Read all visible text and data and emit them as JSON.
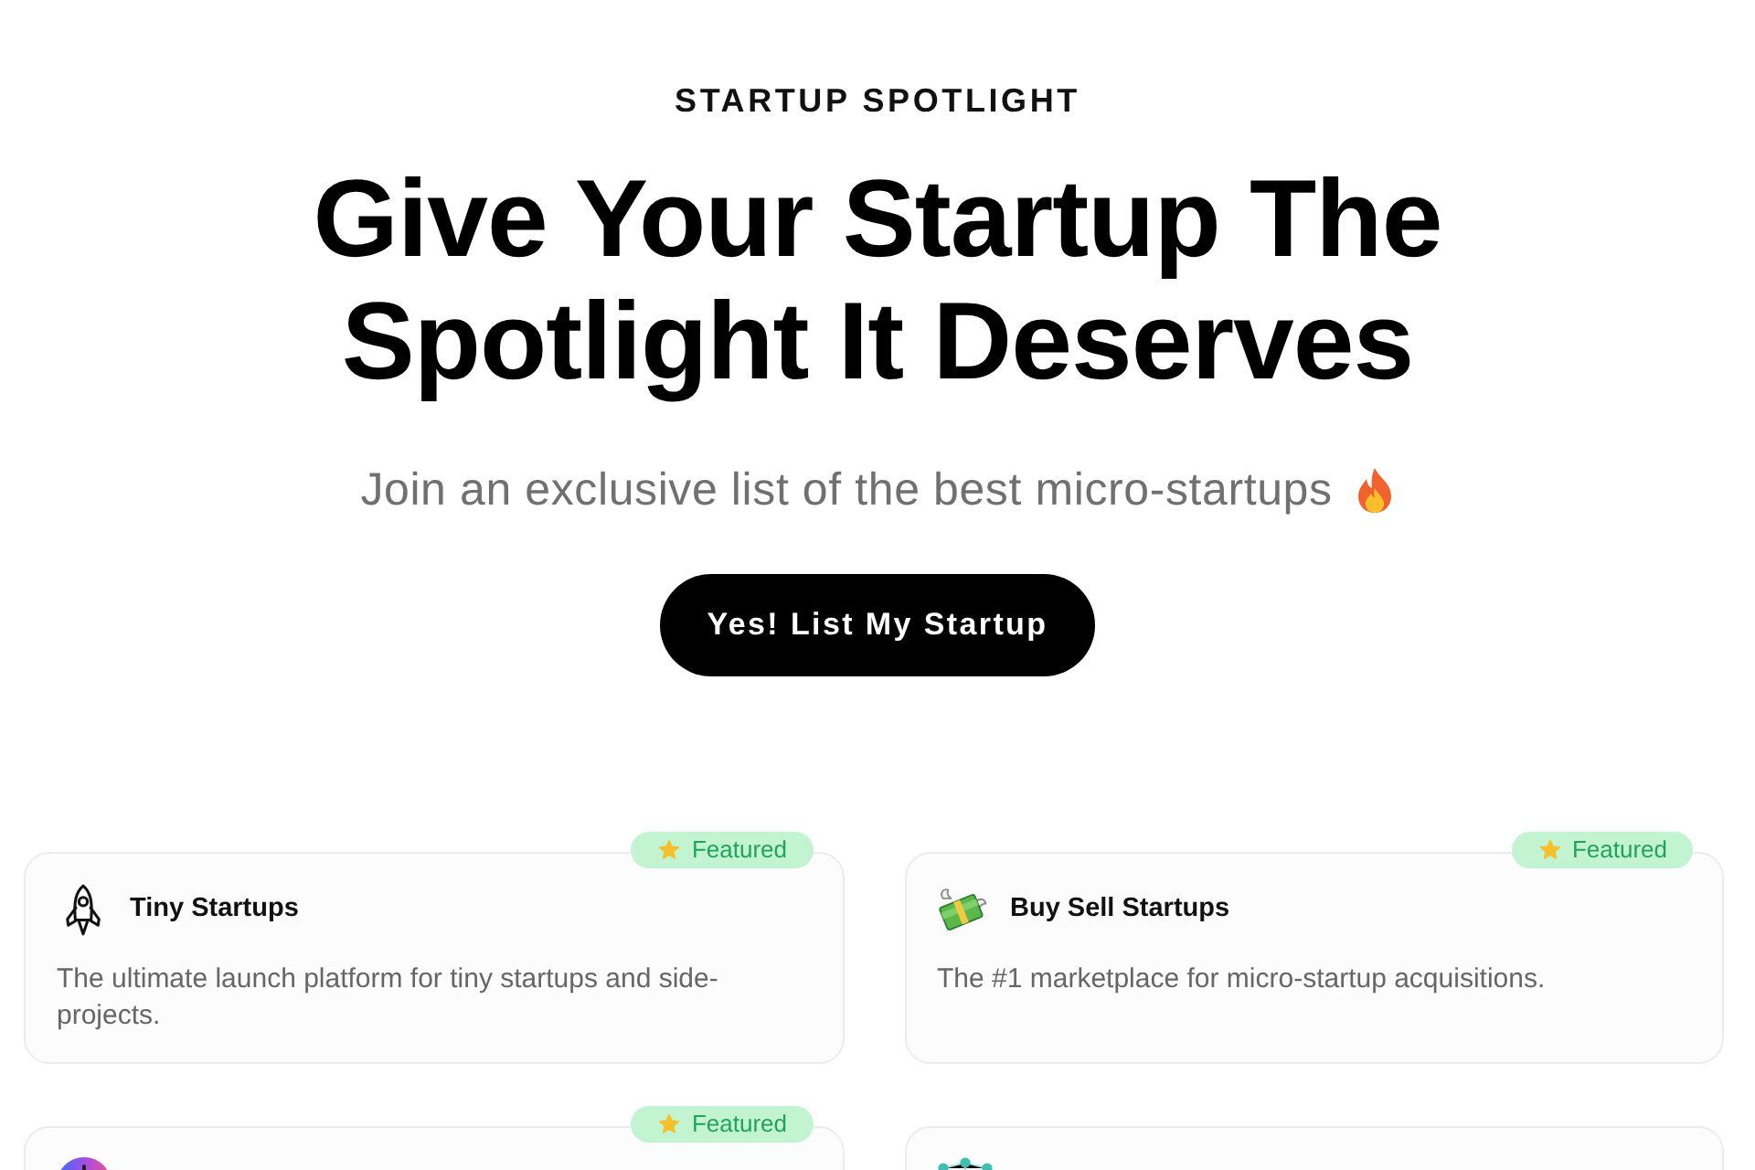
{
  "hero": {
    "eyebrow": "STARTUP SPOTLIGHT",
    "headline": "Give Your Startup The Spotlight It Deserves",
    "subtitle": "Join an exclusive list of the best micro-startups",
    "cta": "Yes! List My Startup"
  },
  "cards": [
    {
      "kind": "rocket",
      "badge": "Featured",
      "title": "Tiny Startups",
      "description": "The ultimate launch platform for tiny startups and side-projects."
    },
    {
      "kind": "money",
      "badge": "Featured",
      "title": "Buy Sell Startups",
      "description": "The #1 marketplace for micro-startup acquisitions."
    },
    {
      "kind": "orb",
      "badge": "Featured"
    },
    {
      "kind": "dots"
    }
  ]
}
